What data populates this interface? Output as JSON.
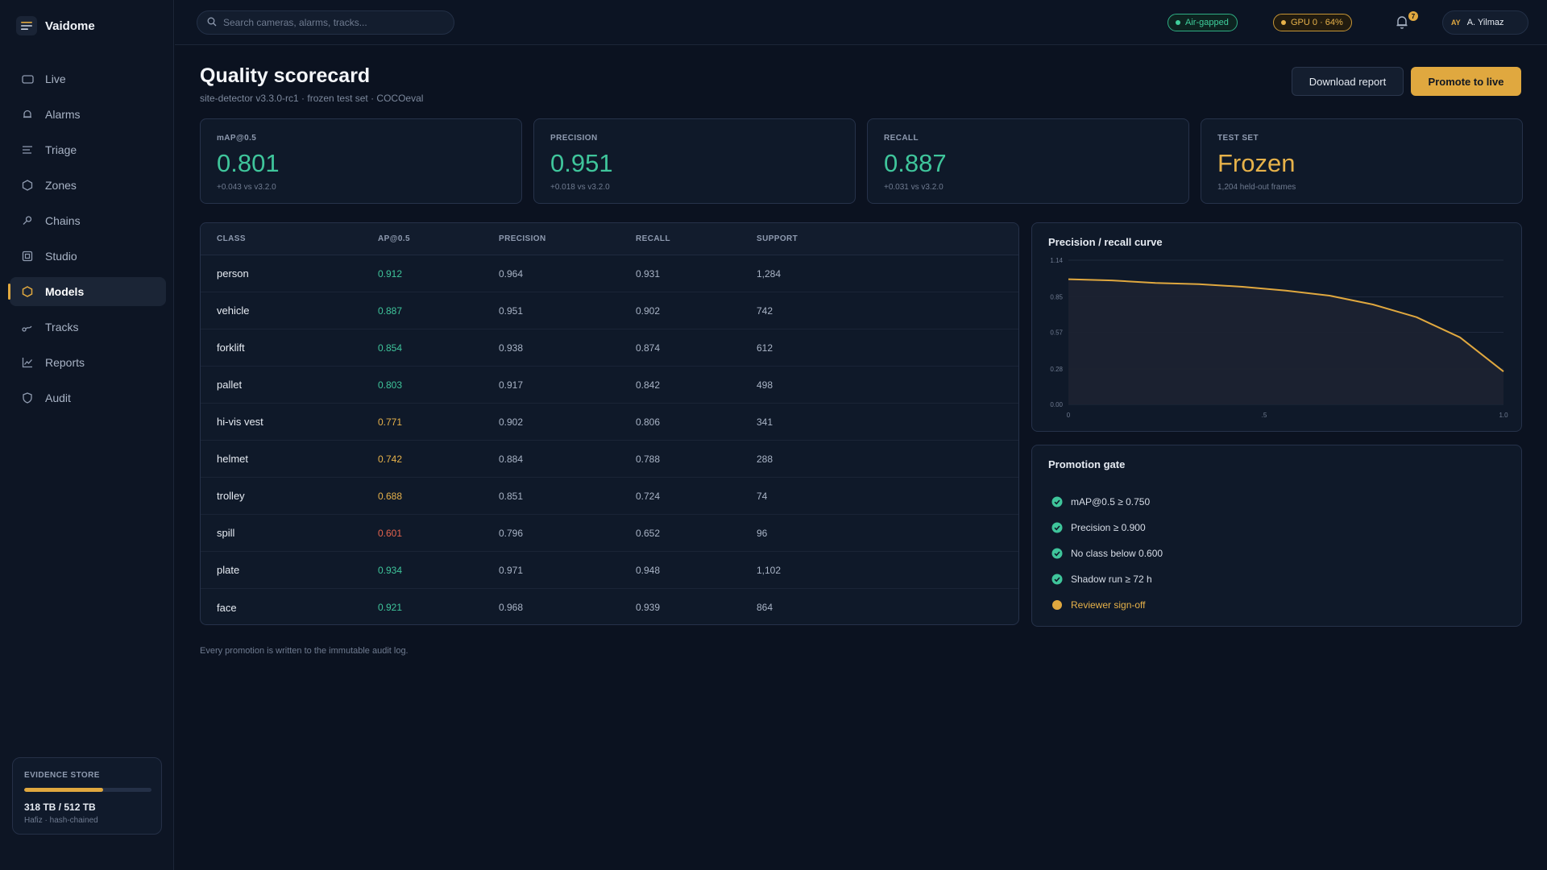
{
  "app": {
    "name": "Vaidome"
  },
  "sidebar": {
    "items": [
      {
        "label": "Live",
        "icon": "tv-icon"
      },
      {
        "label": "Alarms",
        "icon": "bell-icon"
      },
      {
        "label": "Triage",
        "icon": "list-icon"
      },
      {
        "label": "Zones",
        "icon": "hexagon-icon"
      },
      {
        "label": "Chains",
        "icon": "chain-icon"
      },
      {
        "label": "Studio",
        "icon": "square-icon"
      },
      {
        "label": "Models",
        "icon": "hexagon-icon",
        "active": true
      },
      {
        "label": "Tracks",
        "icon": "track-icon"
      },
      {
        "label": "Reports",
        "icon": "chart-icon"
      },
      {
        "label": "Audit",
        "icon": "shield-icon"
      }
    ],
    "storage": {
      "label": "EVIDENCE STORE",
      "value": "318 TB / 512 TB",
      "fraction": 0.62,
      "sub": "Hafiz · hash-chained"
    }
  },
  "topbar": {
    "search_placeholder": "Search cameras, alarms, tracks...",
    "status_air": "Air-gapped",
    "status_gpu": "GPU 0 · 64%",
    "notifications": "7",
    "user": {
      "initials": "AY",
      "name": "A. Yilmaz"
    }
  },
  "header": {
    "title": "Quality scorecard",
    "subtitle": "site-detector v3.3.0-rc1 · frozen test set · COCOeval",
    "download_label": "Download report",
    "promote_label": "Promote to live"
  },
  "kpis": [
    {
      "label": "mAP@0.5",
      "value": "0.801",
      "sub": "+0.043 vs v3.2.0"
    },
    {
      "label": "PRECISION",
      "value": "0.951",
      "sub": "+0.018 vs v3.2.0"
    },
    {
      "label": "RECALL",
      "value": "0.887",
      "sub": "+0.031 vs v3.2.0"
    },
    {
      "label": "TEST SET",
      "value": "Frozen",
      "sub": "1,204 held-out frames"
    }
  ],
  "table": {
    "headers": [
      "CLASS",
      "AP@0.5",
      "PRECISION",
      "RECALL",
      "SUPPORT"
    ],
    "rows": [
      {
        "cls": "person",
        "ap": "0.912",
        "precision": "0.964",
        "recall": "0.931",
        "support": "1,284",
        "color": "#3fc59b"
      },
      {
        "cls": "vehicle",
        "ap": "0.887",
        "precision": "0.951",
        "recall": "0.902",
        "support": "742",
        "color": "#3fc59b"
      },
      {
        "cls": "forklift",
        "ap": "0.854",
        "precision": "0.938",
        "recall": "0.874",
        "support": "612",
        "color": "#3fc59b"
      },
      {
        "cls": "pallet",
        "ap": "0.803",
        "precision": "0.917",
        "recall": "0.842",
        "support": "498",
        "color": "#3fc59b"
      },
      {
        "cls": "hi-vis vest",
        "ap": "0.771",
        "precision": "0.902",
        "recall": "0.806",
        "support": "341",
        "color": "#e7b24a"
      },
      {
        "cls": "helmet",
        "ap": "0.742",
        "precision": "0.884",
        "recall": "0.788",
        "support": "288",
        "color": "#e7b24a"
      },
      {
        "cls": "trolley",
        "ap": "0.688",
        "precision": "0.851",
        "recall": "0.724",
        "support": "74",
        "color": "#e7b24a"
      },
      {
        "cls": "spill",
        "ap": "0.601",
        "precision": "0.796",
        "recall": "0.652",
        "support": "96",
        "color": "#e5644e"
      },
      {
        "cls": "plate",
        "ap": "0.934",
        "precision": "0.971",
        "recall": "0.948",
        "support": "1,102",
        "color": "#3fc59b"
      },
      {
        "cls": "face",
        "ap": "0.921",
        "precision": "0.968",
        "recall": "0.939",
        "support": "864",
        "color": "#3fc59b"
      }
    ]
  },
  "pr_curve": {
    "title": "Precision / recall curve",
    "chart_data": {
      "type": "area",
      "x": [
        0,
        0.1,
        0.2,
        0.3,
        0.4,
        0.5,
        0.6,
        0.7,
        0.8,
        0.9,
        1.0
      ],
      "y": [
        0.99,
        0.98,
        0.96,
        0.95,
        0.93,
        0.9,
        0.86,
        0.79,
        0.69,
        0.53,
        0.26
      ],
      "ylim": [
        0,
        1.14
      ],
      "xlim": [
        0,
        1.0
      ],
      "y_ticks": [
        "0.00",
        "0.28",
        "0.57",
        "0.85",
        "1.14"
      ],
      "x_ticks": [
        {
          "value": 0,
          "label": "0"
        },
        {
          "value": 0.45,
          "label": ".5"
        },
        {
          "value": 1.0,
          "label": "1.0"
        }
      ],
      "line_color": "#e0a83f",
      "grid": true
    }
  },
  "gate": {
    "title": "Promotion gate",
    "items": [
      {
        "label": "mAP@0.5 ≥ 0.750",
        "status": "pass"
      },
      {
        "label": "Precision ≥ 0.900",
        "status": "pass"
      },
      {
        "label": "No class below 0.600",
        "status": "pass"
      },
      {
        "label": "Shadow run ≥ 72 h",
        "status": "pass"
      },
      {
        "label": "Reviewer sign-off",
        "status": "pending"
      }
    ]
  },
  "footnote": "Every promotion is written to the immutable audit log.",
  "colors": {
    "accent": "#e0a83f",
    "good": "#3fc59b",
    "bad": "#e5644e"
  }
}
